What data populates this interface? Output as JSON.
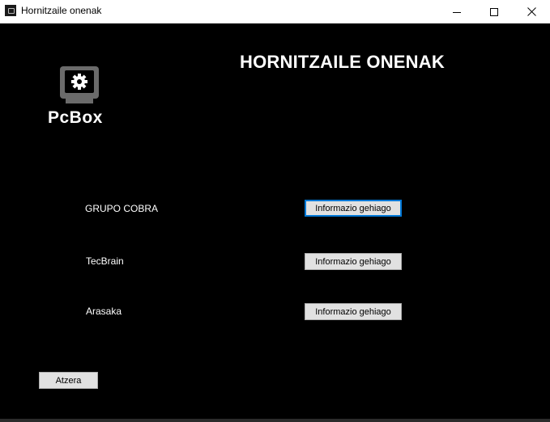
{
  "window": {
    "title": "Hornitzaile onenak",
    "controls": {
      "minimize_icon": "minimize-icon",
      "maximize_icon": "maximize-icon",
      "close_icon": "close-icon"
    }
  },
  "header": {
    "title": "HORNITZAILE ONENAK"
  },
  "logo": {
    "text": "PcBox",
    "icon": "pc-gear-icon"
  },
  "suppliers": [
    {
      "name": "GRUPO COBRA",
      "button_label": "Informazio gehiago",
      "focused": true
    },
    {
      "name": "TecBrain",
      "button_label": "Informazio gehiago",
      "focused": false
    },
    {
      "name": "Arasaka",
      "button_label": "Informazio gehiago",
      "focused": false
    }
  ],
  "footer": {
    "back_label": "Atzera"
  },
  "colors": {
    "background": "#000000",
    "titlebar": "#ffffff",
    "text": "#ffffff",
    "button_face": "#e1e1e1",
    "button_border": "#adadad",
    "focus_border": "#0078d7",
    "logo_gray": "#6b6b6b"
  }
}
